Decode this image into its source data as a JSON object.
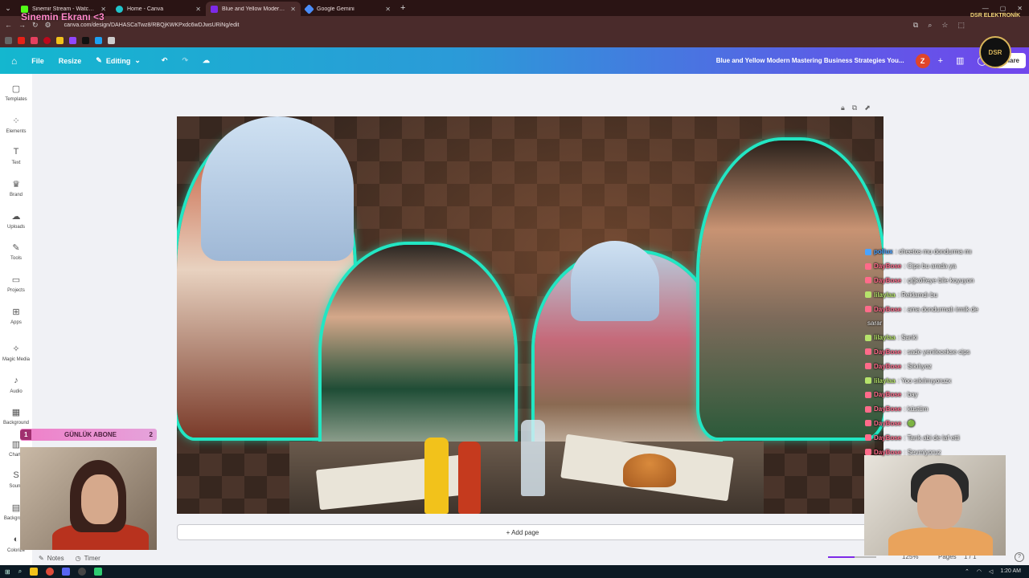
{
  "browser": {
    "tabs": [
      {
        "title": "Sinemir Stream - Watch Live on...",
        "color": "#53fc18",
        "active": false
      },
      {
        "title": "Home - Canva",
        "color": "#20c4cb",
        "active": false
      },
      {
        "title": "Blue and Yellow Modern Maste...",
        "color": "#7d2ae8",
        "active": true
      },
      {
        "title": "Google Gemini",
        "color": "#4a8df8",
        "active": false
      }
    ],
    "new_tab": "+",
    "url": "canva.com/design/DAHASCaTwz8/RBQjKWKPxdc6wDJwsURiNg/edit"
  },
  "stream_overlay": {
    "title": "Sinemin Ekranı <3",
    "brand": "DSR ELEKTRONİK",
    "logo_text": "DSR",
    "sub_counter": {
      "left": "1",
      "label": "GÜNLÜK ABONE",
      "right": "2"
    }
  },
  "canva": {
    "topbar": {
      "file": "File",
      "resize": "Resize",
      "editing": "Editing",
      "doc_title": "Blue and Yellow Modern Mastering Business Strategies You...",
      "avatar_letter": "Z",
      "share": "Share"
    },
    "sidebar": [
      {
        "label": "Templates",
        "icon": "▢"
      },
      {
        "label": "Elements",
        "icon": "⁘"
      },
      {
        "label": "Text",
        "icon": "T"
      },
      {
        "label": "Brand",
        "icon": "♛"
      },
      {
        "label": "Uploads",
        "icon": "☁"
      },
      {
        "label": "Tools",
        "icon": "✎"
      },
      {
        "label": "Projects",
        "icon": "▭"
      },
      {
        "label": "Apps",
        "icon": "⊞"
      },
      {
        "label": "Magic Media",
        "icon": "✧"
      },
      {
        "label": "Audio",
        "icon": "♪"
      },
      {
        "label": "Background",
        "icon": "▦"
      },
      {
        "label": "Charts",
        "icon": "▥"
      },
      {
        "label": "Sound",
        "icon": "S"
      },
      {
        "label": "Backgrou...",
        "icon": "▤"
      },
      {
        "label": "Colorize",
        "icon": "◐"
      }
    ],
    "add_page": "+ Add page",
    "bottom": {
      "notes": "Notes",
      "timer": "Timer",
      "zoom": "125%",
      "zoom_fraction": 0.55,
      "pages_label": "Pages",
      "pages_value": "1 / 1"
    }
  },
  "chat": [
    {
      "user": "pollux",
      "msg": ": cheetos mu dondurma mı",
      "color": "#4aa3ff"
    },
    {
      "user": "DayBose",
      "msg": ": Cips bu arada ya",
      "color": "#ff6b8a"
    },
    {
      "user": "DayBose",
      "msg": ": çiğköfteye bile koyuyon",
      "color": "#ff6b8a"
    },
    {
      "user": "lilaylaa",
      "msg": ": Reklamdı bu",
      "color": "#b6e36b"
    },
    {
      "user": "DayBose",
      "msg": ": ama dondurmalı irmik de",
      "color": "#ff6b8a"
    },
    {
      "user": "",
      "msg": "sarar",
      "color": "#ffffff"
    },
    {
      "user": "lilaylaa",
      "msg": ": Sanki",
      "color": "#b6e36b"
    },
    {
      "user": "DayBose",
      "msg": ": sade yenilecekse cips",
      "color": "#ff6b8a"
    },
    {
      "user": "DayBose",
      "msg": ": Sıkılıyoz",
      "color": "#ff6b8a"
    },
    {
      "user": "lilaylaa",
      "msg": ": Yoo sıkılmıyoruzx",
      "color": "#b6e36b"
    },
    {
      "user": "DayBose",
      "msg": ": bay",
      "color": "#ff6b8a"
    },
    {
      "user": "DayBose",
      "msg": ": küstüm",
      "color": "#ff6b8a"
    },
    {
      "user": "DayBose",
      "msg": ": 🟢",
      "color": "#ff6b8a"
    },
    {
      "user": "DayBose",
      "msg": ": Tarık abi de laf etti",
      "color": "#ff6b8a"
    },
    {
      "user": "DayBose",
      "msg": ": Sevmiyoruz",
      "color": "#ff6b8a"
    }
  ],
  "taskbar": {
    "time": "1:20 AM"
  }
}
